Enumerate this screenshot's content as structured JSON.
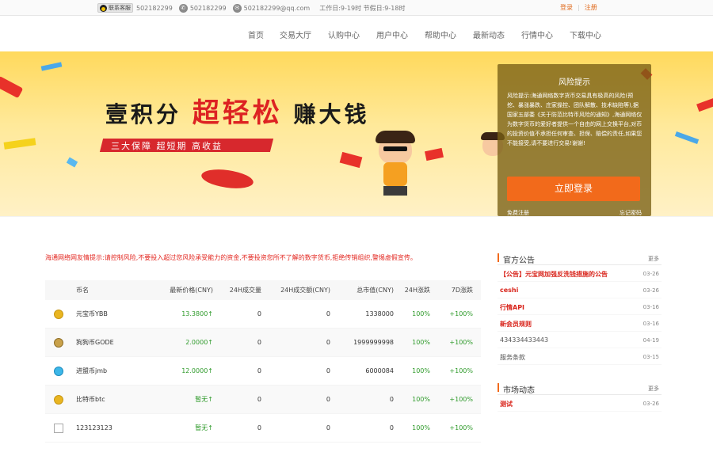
{
  "topbar": {
    "qq_label": "联系客服",
    "qq_number": "502182299",
    "phone": "502182299",
    "email": "502182299@qq.com",
    "hours": "工作日:9-19时 节假日:9-18时",
    "login": "登录",
    "register": "注册",
    "phone_icon": "phone-icon",
    "mail_icon": "mail-icon"
  },
  "nav": {
    "items": [
      "首页",
      "交易大厅",
      "认购中心",
      "用户中心",
      "帮助中心",
      "最新动态",
      "行情中心",
      "下载中心"
    ]
  },
  "banner": {
    "slogan_a": "壹积分",
    "slogan_b": "超轻松",
    "slogan_c": "赚大钱",
    "ribbon": "三大保障 超短期 高收益",
    "risk_title": "风险提示",
    "risk_text": "风险提示:海通网络数字货币交易具有极高的风险(预挖、暴涨暴跌、庄家操控、团队解散、技术缺陷等),据国家五部委《关于防范比特币风险的通知》,海通网络仅为数字货币的爱好者提供一个自由的网上交换平台,对币的投资价值不承担任何审查、担保、赔偿的责任,如果您不能接受,请不要进行交易!谢谢!",
    "login_button": "立即登录",
    "link_left": "免费注册",
    "link_right": "忘记密码",
    "slide_count": 4,
    "active_slide": 2
  },
  "notice": "海通网络网友情提示:请控制风险,不要投入超过您风险承受能力的资金,不要投资您所不了解的数字货币,拒绝传销组织,警惕虚假宣传。",
  "market": {
    "headers": [
      "币名",
      "最新价格(CNY)",
      "24H成交量",
      "24H成交额(CNY)",
      "总市值(CNY)",
      "24H涨跌",
      "7D涨跌"
    ],
    "rows": [
      {
        "name": "元宝币YBB",
        "price": "13.3800↑",
        "vol": "0",
        "amount": "0",
        "cap": "1338000",
        "h24": "100%",
        "d7": "+100%",
        "icon": "coin-icon"
      },
      {
        "name": "狗狗币GODE",
        "price": "2.0000↑",
        "vol": "0",
        "amount": "0",
        "cap": "1999999998",
        "h24": "100%",
        "d7": "+100%",
        "icon": "coin-icon"
      },
      {
        "name": "进盟币jmb",
        "price": "12.0000↑",
        "vol": "0",
        "amount": "0",
        "cap": "6000084",
        "h24": "100%",
        "d7": "+100%",
        "icon": "coin-icon"
      },
      {
        "name": "比特币btc",
        "price": "暂无↑",
        "vol": "0",
        "amount": "0",
        "cap": "0",
        "h24": "100%",
        "d7": "+100%",
        "icon": "coin-icon"
      },
      {
        "name": "123123123",
        "price": "暂无↑",
        "vol": "0",
        "amount": "0",
        "cap": "0",
        "h24": "100%",
        "d7": "+100%",
        "icon": "broken-image-icon"
      }
    ]
  },
  "announcements": {
    "title": "官方公告",
    "more": "更多",
    "items": [
      {
        "text": "【公告】元宝网加强反洗钱措施的公告",
        "date": "03-26",
        "style": "red"
      },
      {
        "text": "ceshi",
        "date": "03-26",
        "style": "red"
      },
      {
        "text": "行情API",
        "date": "03-16",
        "style": "red"
      },
      {
        "text": "新会员规则",
        "date": "03-16",
        "style": "red"
      },
      {
        "text": "434334433443",
        "date": "04-19",
        "style": "grey"
      },
      {
        "text": "服务条款",
        "date": "03-15",
        "style": "grey"
      }
    ]
  },
  "market_news": {
    "title": "市场动态",
    "more": "更多",
    "items": [
      {
        "text": "测试",
        "date": "03-26",
        "style": "red"
      }
    ]
  },
  "colors": {
    "accent": "#f26a1b",
    "up_green": "#2e9a2a",
    "notice_red": "#e3261f"
  }
}
